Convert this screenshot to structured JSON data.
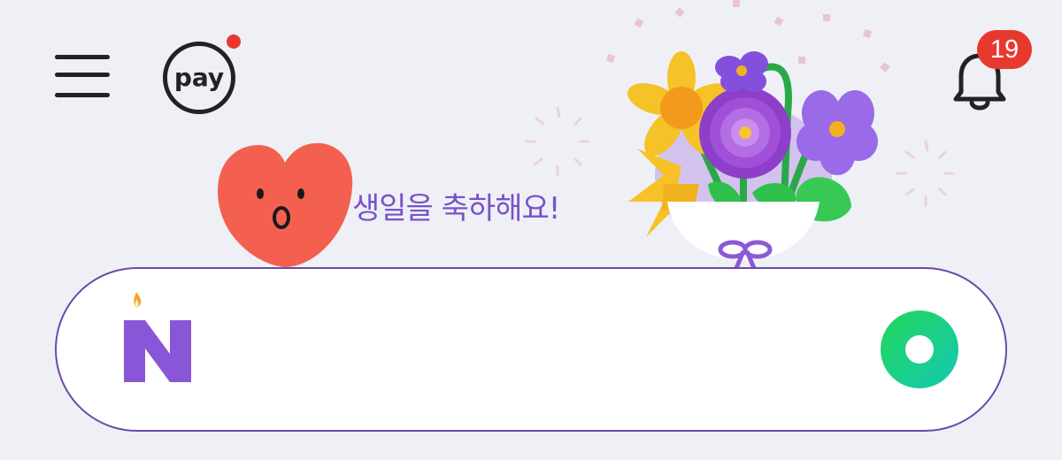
{
  "header": {
    "menu_icon": "hamburger-menu-icon",
    "pay_label": "pay",
    "pay_dot_color": "#e8392f",
    "notifications": {
      "count": "19",
      "badge_color": "#e8392f",
      "icon": "bell-icon"
    }
  },
  "greeting": {
    "text": "생일을 축하해요!",
    "color": "#7b52c9"
  },
  "search": {
    "value": "",
    "placeholder": "",
    "logo_icon": "birthday-candle-n-logo-icon",
    "action_icon": "green-circle-icon"
  },
  "colors": {
    "background": "#eef0f6",
    "search_border": "#6a4aa8",
    "accent_purple": "#8c5ad6",
    "accent_green": "#1ed760"
  }
}
